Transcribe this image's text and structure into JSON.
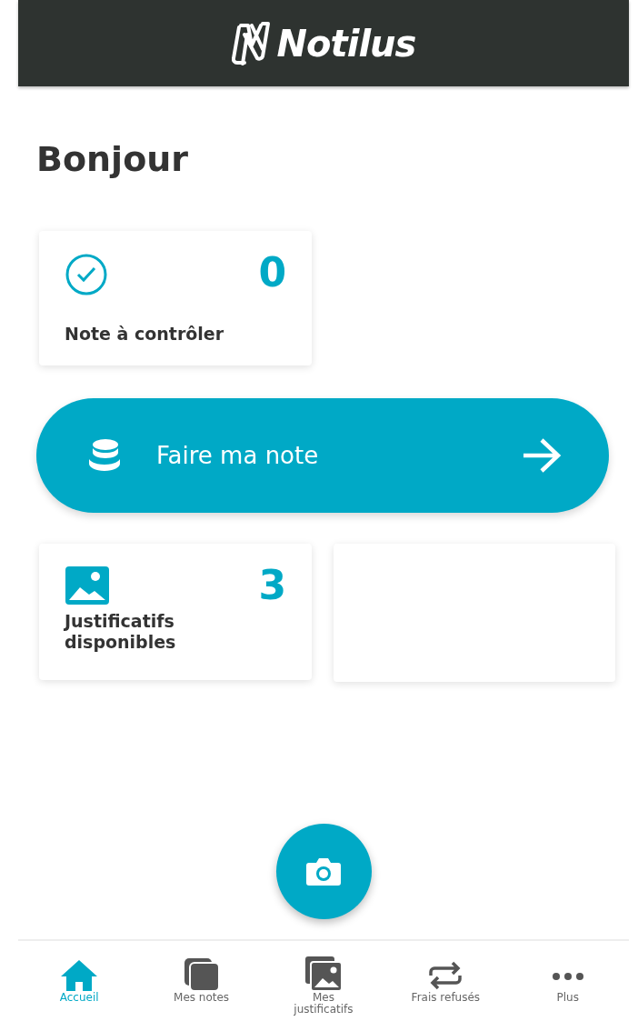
{
  "header": {
    "logo_text": "Notilus"
  },
  "greeting": "Bonjour",
  "top_tiles": [
    {
      "kind": "check",
      "count": "0",
      "label": "Note à contrôler"
    }
  ],
  "action_button": {
    "label": "Faire ma note"
  },
  "bottom_tiles": [
    {
      "kind": "image",
      "count": "3",
      "label": "Justificatifs disponibles"
    },
    {
      "kind": "blank"
    }
  ],
  "nav": [
    {
      "kind": "home",
      "label": "Accueil",
      "selected": true
    },
    {
      "kind": "stack",
      "label": "Mes notes",
      "selected": false
    },
    {
      "kind": "images",
      "label": "Mes justificatifs",
      "selected": false
    },
    {
      "kind": "swap",
      "label": "Frais refusés",
      "selected": false
    },
    {
      "kind": "dots",
      "label": "Plus",
      "selected": false
    }
  ]
}
